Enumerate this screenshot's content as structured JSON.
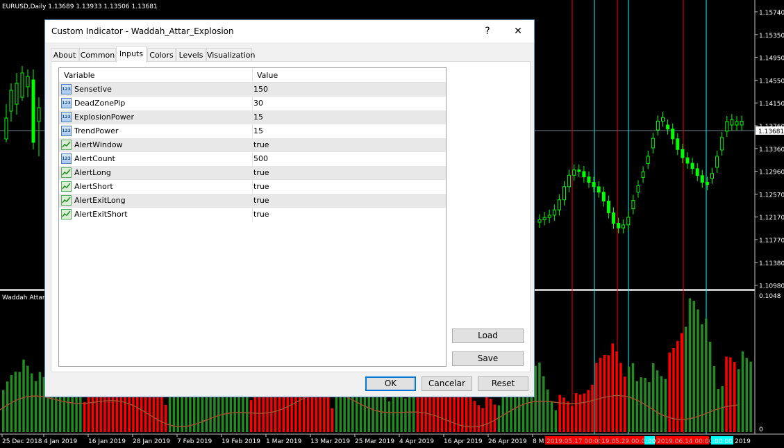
{
  "chart": {
    "header": "EURUSD,Daily  1.13689 1.13933 1.13506 1.13681",
    "indicator_label": "Waddah Attar",
    "price_labels": [
      "1.15740",
      "1.15350",
      "1.14950",
      "1.14550",
      "1.14150",
      "1.13760",
      "1.13360",
      "1.12960",
      "1.12570",
      "1.12170",
      "1.11770",
      "1.11380",
      "1.10980"
    ],
    "current_price": "1.13681",
    "indicator_scale": [
      "0.1048",
      "0"
    ],
    "date_labels": [
      "25 Dec 2018",
      "4 Jan 2019",
      "16 Jan 2019",
      "28 Jan 2019",
      "7 Feb 2019",
      "19 Feb 2019",
      "1 Mar 2019",
      "13 Mar 2019",
      "25 Mar 2019",
      "4 Apr 2019",
      "16 Apr 2019",
      "26 Apr 2019",
      "8 M"
    ],
    "vline_labels": [
      {
        "text": "2019.05.17 00:00",
        "color": "#ff0000"
      },
      {
        "text": "19.05.29 00:00",
        "color": "#ff0000"
      },
      {
        "text": ":00",
        "color": "#00ffff"
      },
      {
        "text": "2019.06.14 00:00",
        "color": "#ff0000"
      },
      {
        "text": ":00:00",
        "color": "#00ffff"
      },
      {
        "text": "2019",
        "color": "#000000"
      }
    ],
    "colors": {
      "bull": "#00ff00",
      "bear": "#ff0000",
      "up_hist": "#228b22",
      "down_hist": "#ff0000",
      "explosion": "#a0522d",
      "cyan": "#00ffff",
      "grid": "#4d4d4d"
    }
  },
  "dialog": {
    "title": "Custom Indicator - Waddah_Attar_Explosion",
    "help": "?",
    "close": "✕",
    "tabs": [
      "About",
      "Common",
      "Inputs",
      "Colors",
      "Levels",
      "Visualization"
    ],
    "active_tab": "Inputs",
    "columns": {
      "variable": "Variable",
      "value": "Value"
    },
    "inputs": [
      {
        "icon": "number-icon",
        "name": "Sensetive",
        "value": "150"
      },
      {
        "icon": "number-icon",
        "name": "DeadZonePip",
        "value": "30"
      },
      {
        "icon": "number-icon",
        "name": "ExplosionPower",
        "value": "15"
      },
      {
        "icon": "number-icon",
        "name": "TrendPower",
        "value": "15"
      },
      {
        "icon": "boolean-icon",
        "name": "AlertWindow",
        "value": "true"
      },
      {
        "icon": "number-icon",
        "name": "AlertCount",
        "value": "500"
      },
      {
        "icon": "boolean-icon",
        "name": "AlertLong",
        "value": "true"
      },
      {
        "icon": "boolean-icon",
        "name": "AlertShort",
        "value": "true"
      },
      {
        "icon": "boolean-icon",
        "name": "AlertExitLong",
        "value": "true"
      },
      {
        "icon": "boolean-icon",
        "name": "AlertExitShort",
        "value": "true"
      }
    ],
    "number_icon_text": "123",
    "buttons": {
      "load": "Load",
      "save": "Save",
      "ok": "OK",
      "cancel": "Cancelar",
      "reset": "Reset"
    }
  }
}
